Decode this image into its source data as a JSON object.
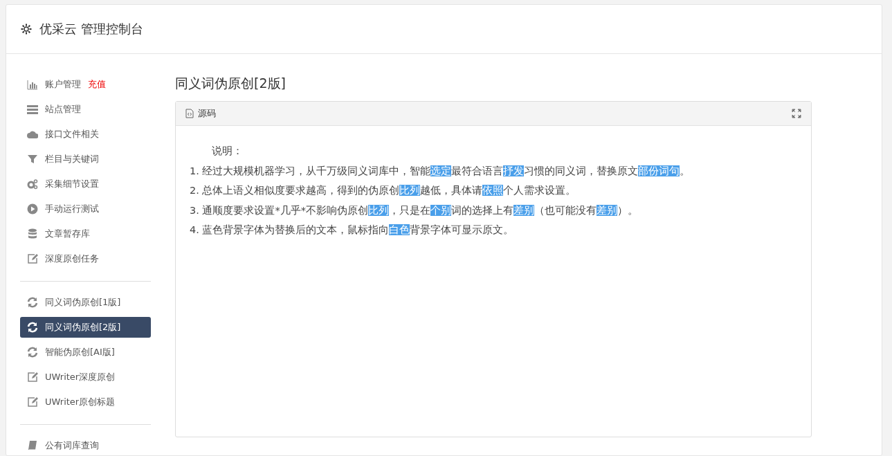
{
  "header": {
    "title": "优采云 管理控制台"
  },
  "sidebar": {
    "groups": [
      {
        "items": [
          {
            "label": "账户管理",
            "badge": "充值",
            "kind": "chart",
            "selected": false
          },
          {
            "label": "站点管理",
            "kind": "server",
            "selected": false
          },
          {
            "label": "接口文件相关",
            "kind": "cloud",
            "selected": false
          },
          {
            "label": "栏目与关键词",
            "kind": "filter",
            "selected": false
          },
          {
            "label": "采集细节设置",
            "kind": "gears",
            "selected": false
          },
          {
            "label": "手动运行测试",
            "kind": "play",
            "selected": false
          },
          {
            "label": "文章暂存库",
            "kind": "database",
            "selected": false
          },
          {
            "label": "深度原创任务",
            "kind": "edit",
            "selected": false
          }
        ]
      },
      {
        "items": [
          {
            "label": "同义词伪原创[1版]",
            "kind": "refresh",
            "selected": false
          },
          {
            "label": "同义词伪原创[2版]",
            "kind": "refresh",
            "selected": true
          },
          {
            "label": "智能伪原创[AI版]",
            "kind": "refresh",
            "selected": false
          },
          {
            "label": "UWriter深度原创",
            "kind": "edit",
            "selected": false
          },
          {
            "label": "UWriter原创标题",
            "kind": "edit",
            "selected": false
          }
        ]
      },
      {
        "items": [
          {
            "label": "公有词库查询",
            "kind": "book",
            "selected": false
          }
        ]
      }
    ]
  },
  "page_title": "同义词伪原创[2版]",
  "panel": {
    "title": "源码",
    "heading": "说明：",
    "lines": [
      [
        {
          "text": "1. 经过大规模机器学习，从千万级同义词库中，智能",
          "highlighted": false
        },
        {
          "text": "选定",
          "highlighted": true
        },
        {
          "text": "最符合语言",
          "highlighted": false
        },
        {
          "text": "抒发",
          "highlighted": true
        },
        {
          "text": "习惯的同义词，替换原文",
          "highlighted": false
        },
        {
          "text": "部份",
          "highlighted": true
        },
        {
          "text": "词句",
          "highlighted": true
        },
        {
          "text": "。",
          "highlighted": false
        }
      ],
      [
        {
          "text": "2. 总体上语义相似度要求越高，得到的伪原创",
          "highlighted": false
        },
        {
          "text": "比列",
          "highlighted": true
        },
        {
          "text": "越低，具体请",
          "highlighted": false
        },
        {
          "text": "依照",
          "highlighted": true
        },
        {
          "text": "个人需求设置。",
          "highlighted": false
        }
      ],
      [
        {
          "text": "3. 通顺度要求设置*几乎*不影响伪原创",
          "highlighted": false
        },
        {
          "text": "比列",
          "highlighted": true
        },
        {
          "text": "，只是在",
          "highlighted": false
        },
        {
          "text": "个别",
          "highlighted": true
        },
        {
          "text": "词的选择上有",
          "highlighted": false
        },
        {
          "text": "差别",
          "highlighted": true
        },
        {
          "text": "（也可能没有",
          "highlighted": false
        },
        {
          "text": "差别",
          "highlighted": true
        },
        {
          "text": "）。",
          "highlighted": false
        }
      ],
      [
        {
          "text": "4. 蓝色背景字体为替换后的文本，鼠标指向",
          "highlighted": false
        },
        {
          "text": "白色",
          "highlighted": true
        },
        {
          "text": "背景字体可显示原文。",
          "highlighted": false
        }
      ]
    ]
  }
}
